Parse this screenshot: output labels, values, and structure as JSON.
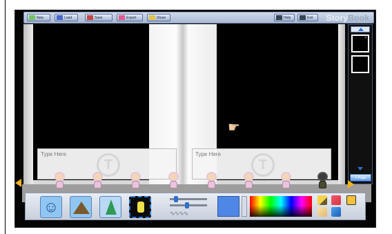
{
  "toolbar": {
    "buttons": [
      {
        "icon": "new-icon",
        "label": "New"
      },
      {
        "icon": "load-icon",
        "label": "Load"
      },
      {
        "icon": "save-icon",
        "label": "Save"
      },
      {
        "icon": "export-icon",
        "label": "Export"
      },
      {
        "icon": "share-icon",
        "label": "Share"
      }
    ],
    "right_buttons": [
      {
        "icon": "help-icon",
        "label": "Help"
      },
      {
        "icon": "exit-icon",
        "label": "Exit"
      }
    ],
    "logo": {
      "part1": "Story",
      "part2": "Book"
    }
  },
  "book": {
    "left_textbox": {
      "placeholder": "Type Here"
    },
    "right_textbox": {
      "placeholder": "Type Here"
    }
  },
  "pages_panel": {
    "add_page_label": "+ Page"
  },
  "character_strip": {
    "count": 8
  },
  "tools": {
    "active_color": "#4e87e6"
  }
}
